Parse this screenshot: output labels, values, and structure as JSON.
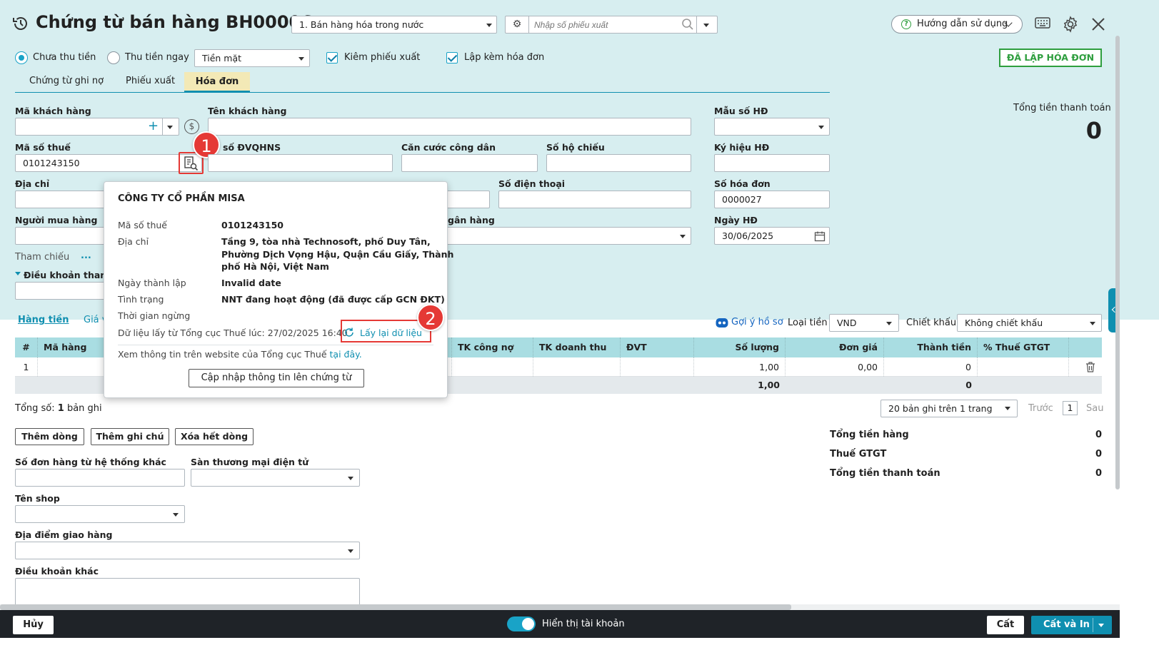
{
  "header": {
    "title": "Chứng từ bán hàng BH00006",
    "sale_type": "1. Bán hàng hóa trong nước",
    "export_placeholder": "Nhập số phiếu xuất",
    "help_label": "Hướng dẫn sử dụng"
  },
  "options": {
    "radio_unpaid": "Chưa thu tiền",
    "radio_paid": "Thu tiền ngay",
    "payment_method": "Tiền mặt",
    "chk_export": "Kiêm phiếu xuất",
    "chk_invoice": "Lập kèm hóa đơn",
    "invoice_badge": "ĐÃ LẬP HÓA ĐƠN"
  },
  "tabs": [
    "Chứng từ ghi nợ",
    "Phiếu xuất",
    "Hóa đơn"
  ],
  "form": {
    "customer_code_label": "Mã khách hàng",
    "customer_name_label": "Tên khách hàng",
    "tax_code_label": "Mã số thuế",
    "tax_code_value": "0101243150",
    "budget_code_label": "Mã số ĐVQHNS",
    "budget_code_partial": "số ĐVQHNS",
    "citizen_id_label": "Căn cước công dân",
    "passport_label": "Số hộ chiếu",
    "address_label": "Địa chỉ",
    "phone_label": "Số điện thoại",
    "buyer_label": "Người mua hàng",
    "bank_label_partial": "gân hàng",
    "reference_label": "Tham chiếu",
    "reference_more": "...",
    "payment_terms_label": "Điều khoản thanh t",
    "invoice_template_label": "Mẫu số HĐ",
    "invoice_symbol_label": "Ký hiệu HĐ",
    "invoice_number_label": "Số hóa đơn",
    "invoice_number_value": "0000027",
    "invoice_date_label": "Ngày HĐ",
    "invoice_date_value": "30/06/2025",
    "total_label": "Tổng tiền thanh toán",
    "total_value": "0"
  },
  "popup": {
    "company": "CÔNG TY CỔ PHẦN MISA",
    "tax_label": "Mã số thuế",
    "tax_value": "0101243150",
    "address_label": "Địa chỉ",
    "address_line1": "Tầng 9, tòa nhà Technosoft, phố Duy Tân,",
    "address_line2": "Phường Dịch Vọng Hậu, Quận Cầu Giấy, Thành",
    "address_line3": "phố Hà Nội, Việt Nam",
    "founded_label": "Ngày thành lập",
    "founded_value": "Invalid date",
    "status_label": "Tình trạng",
    "status_value": "NNT đang hoạt động (đã được cấp GCN ĐKT)",
    "stop_label": "Thời gian ngừng",
    "source_text": "Dữ liệu lấy từ Tổng cục Thuế lúc: 27/02/2025 16:40",
    "refresh_label": "Lấy lại dữ liệu",
    "website_text": "Xem thông tin trên website của Tổng cục Thuế",
    "website_link": "tại đây.",
    "update_button": "Cập nhập thông tin lên chứng từ"
  },
  "markers": [
    "1",
    "2"
  ],
  "grid_toolbar": {
    "tab_goods": "Hàng tiền",
    "tab_price_partial": "Giá v",
    "suggest_label": "Gợi ý hồ sơ",
    "currency_label": "Loại tiền",
    "currency_value": "VND",
    "discount_label": "Chiết khấu",
    "discount_value": "Không chiết khấu"
  },
  "table": {
    "headers": [
      "#",
      "Mã hàng",
      "TK công nợ",
      "TK doanh thu",
      "ĐVT",
      "Số lượng",
      "Đơn giá",
      "Thành tiền",
      "% Thuế GTGT"
    ],
    "row": {
      "index": "1",
      "quantity": "1,00",
      "unit_price": "0,00",
      "amount": "0"
    },
    "footer": {
      "quantity": "1,00",
      "amount": "0"
    }
  },
  "paging": {
    "total_prefix": "Tổng số:",
    "total_count": "1",
    "total_suffix": "bản ghi",
    "page_size": "20 bản ghi trên 1 trang",
    "prev": "Trước",
    "page": "1",
    "next": "Sau"
  },
  "row_buttons": [
    "Thêm dòng",
    "Thêm ghi chú",
    "Xóa hết dòng"
  ],
  "extra": {
    "order_no_label": "Số đơn hàng từ hệ thống khác",
    "ecommerce_label": "Sàn thương mại điện tử",
    "shop_label": "Tên shop",
    "delivery_label": "Địa điểm giao hàng",
    "other_terms_label": "Điều khoản khác"
  },
  "summary": [
    {
      "label": "Tổng tiền hàng",
      "value": "0"
    },
    {
      "label": "Thuế GTGT",
      "value": "0"
    },
    {
      "label": "Tổng tiền thanh toán",
      "value": "0"
    }
  ],
  "footer_bar": {
    "cancel": "Hủy",
    "show_account": "Hiển thị tài khoản",
    "save": "Cất",
    "save_print": "Cất và In"
  },
  "colors": {
    "teal_bg": "#d7eef0",
    "accent": "#0f8fb0",
    "green": "#2e9e3e",
    "red": "#e53935",
    "dark": "#1f2328"
  }
}
